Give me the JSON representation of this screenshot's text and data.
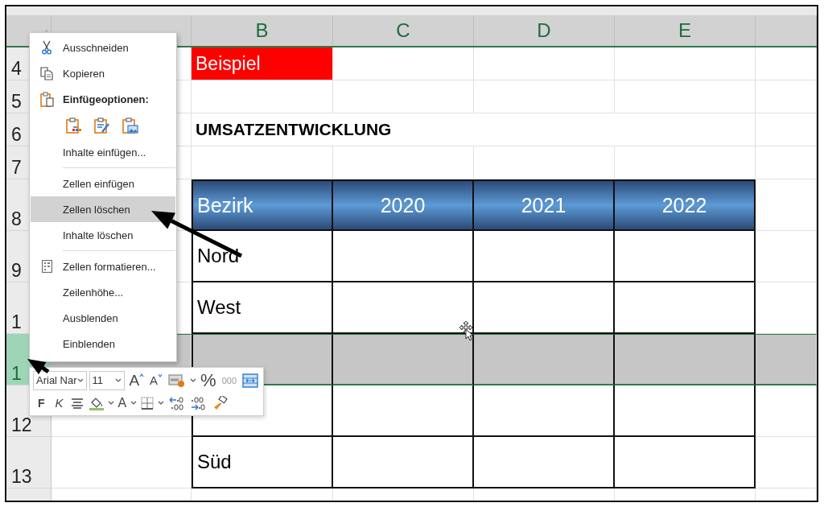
{
  "sheet": {
    "columns": [
      "B",
      "C",
      "D",
      "E"
    ],
    "rows": [
      {
        "header": "4",
        "selected": false,
        "kind": "label",
        "cells": [
          "Beispiel"
        ]
      },
      {
        "header": "5",
        "selected": false,
        "kind": "blank"
      },
      {
        "header": "6",
        "selected": false,
        "kind": "title",
        "cells": [
          "UMSATZENTWICKLUNG"
        ]
      },
      {
        "header": "7",
        "selected": false,
        "kind": "blank"
      },
      {
        "header": "8",
        "selected": false,
        "kind": "table_head",
        "cells": [
          "Bezirk",
          "2020",
          "2021",
          "2022"
        ]
      },
      {
        "header": "9",
        "selected": false,
        "kind": "table_row",
        "cells": [
          "Nord"
        ]
      },
      {
        "header": "1",
        "selected": false,
        "kind": "table_row",
        "cells": [
          "West"
        ]
      },
      {
        "header": "1",
        "selected": true,
        "kind": "table_row"
      },
      {
        "header": "12",
        "selected": false,
        "kind": "table_row"
      },
      {
        "header": "13",
        "selected": false,
        "kind": "table_row",
        "cells": [
          "Süd"
        ]
      },
      {
        "selected": false,
        "kind": "blank"
      }
    ]
  },
  "context_menu": {
    "items": [
      {
        "kind": "cut",
        "label": "Ausschneiden",
        "selected": false
      },
      {
        "kind": "copy",
        "label": "Kopieren",
        "selected": false
      },
      {
        "kind": "paste_heading",
        "label": "Einfügeoptionen:",
        "selected": false
      },
      {
        "kind": "paste_options"
      },
      {
        "kind": "item",
        "label": "Inhalte einfügen...",
        "selected": false
      },
      {
        "kind": "separator"
      },
      {
        "kind": "item",
        "label": "Zellen einfügen",
        "selected": false
      },
      {
        "kind": "item",
        "label": "Zellen löschen",
        "selected": true
      },
      {
        "kind": "item",
        "label": "Inhalte löschen",
        "selected": false
      },
      {
        "kind": "separator"
      },
      {
        "kind": "format",
        "label": "Zellen formatieren...",
        "selected": false
      },
      {
        "kind": "item",
        "label": "Zeilenhöhe...",
        "selected": false
      },
      {
        "kind": "item",
        "label": "Ausblenden",
        "selected": false
      },
      {
        "kind": "item",
        "label": "Einblenden",
        "selected": false
      }
    ]
  },
  "mini_toolbar": {
    "first_line": [
      {
        "kind": "font_field",
        "value": "Arial Nar"
      },
      {
        "kind": "size_field",
        "value": "11"
      },
      {
        "kind": "grow",
        "label": "A"
      },
      {
        "kind": "shrink",
        "label": "A"
      },
      {
        "kind": "cell_styles"
      },
      {
        "kind": "glyph",
        "label": "%"
      },
      {
        "kind": "thousands",
        "label": "000"
      },
      {
        "kind": "merge"
      }
    ],
    "second_line": [
      {
        "kind": "bold",
        "label": "F"
      },
      {
        "kind": "italic",
        "label": "K"
      },
      {
        "kind": "align"
      },
      {
        "kind": "fill_color"
      },
      {
        "kind": "font_color",
        "label": "A"
      },
      {
        "kind": "borders"
      },
      {
        "kind": "add_decimal"
      },
      {
        "kind": "remove_decimal"
      },
      {
        "kind": "painter"
      }
    ]
  }
}
